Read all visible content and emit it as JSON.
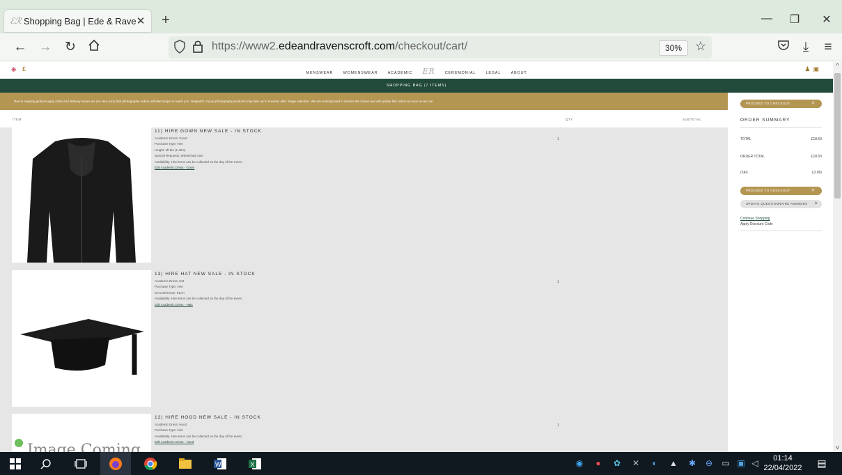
{
  "browser": {
    "tab_title": "Shopping Bag | Ede & Ravenscr",
    "tab_favicon": "ER",
    "new_tab": "+",
    "url_prefix": "https://www2.",
    "url_domain": "edeandravenscroft.com",
    "url_path": "/checkout/cart/",
    "zoom": "30%"
  },
  "site": {
    "currency": "£",
    "nav": [
      "MENSWEAR",
      "WOMENSWEAR",
      "ACADEMIC",
      "CEREMONIAL",
      "LEGAL",
      "ABOUT"
    ],
    "logo": "ER",
    "bag_bar": "SHOPPING BAG (7 ITEMS)",
    "notice": "Due to ongoing global supply chain and delivery issues we are very sorry that photography orders will take longer to reach you. Despatch of your photography products may take up to 8 weeks after image selection. We are working hard to resolve the issues and will update this notice as soon as we can.",
    "col_item": "ITEM",
    "col_qty": "QTY",
    "col_subtotal": "SUBTOTAL"
  },
  "items": [
    {
      "title": "11) HIRE GOWN NEW SALE - IN STOCK",
      "lines": [
        "Academic Dress: Gown",
        "Purchase Type: Hire",
        "Height: 4ft 8in (1.42m)",
        "Special Requests: Wheelchair user",
        "Availability: Hire items can be collected on the day of the event."
      ],
      "link": "Edit Academic Dress - Gown",
      "qty": "1"
    },
    {
      "title": "13) HIRE HAT NEW SALE - IN STOCK",
      "lines": [
        "Academic Dress: Hat",
        "Purchase Type: Hire",
        "Circumference: 51cm",
        "Availability: Hire items can be collected on the day of the event."
      ],
      "link": "Edit Academic Dress - Hats",
      "qty": "1"
    },
    {
      "title": "12) HIRE HOOD NEW SALE - IN STOCK",
      "lines": [
        "Academic Dress: Hood",
        "Purchase Type: Hire",
        "Availability: Hire items can be collected on the day of the event."
      ],
      "link": "Edit Academic Dress - Hood",
      "qty": "1",
      "image_text": "Image Coming"
    }
  ],
  "summary": {
    "checkout_top": "PROCEED TO CHECKOUT",
    "title": "ORDER SUMMARY",
    "total_label": "TOTAL",
    "total_value": "£18.50",
    "order_total_label": "ORDER TOTAL",
    "order_total_value": "£18.50",
    "tax_label": "(TAX",
    "tax_value": "£3.08)",
    "checkout_bottom": "PROCEED TO CHECKOUT",
    "update": "UPDATE QUESTIONNAIRE ANSWERS",
    "continue": "Continue Shopping",
    "discount": "Apply Discount Code"
  },
  "taskbar": {
    "time": "01:14",
    "date": "22/04/2022"
  },
  "colors": {
    "green": "#214a3a",
    "gold": "#b49653"
  }
}
